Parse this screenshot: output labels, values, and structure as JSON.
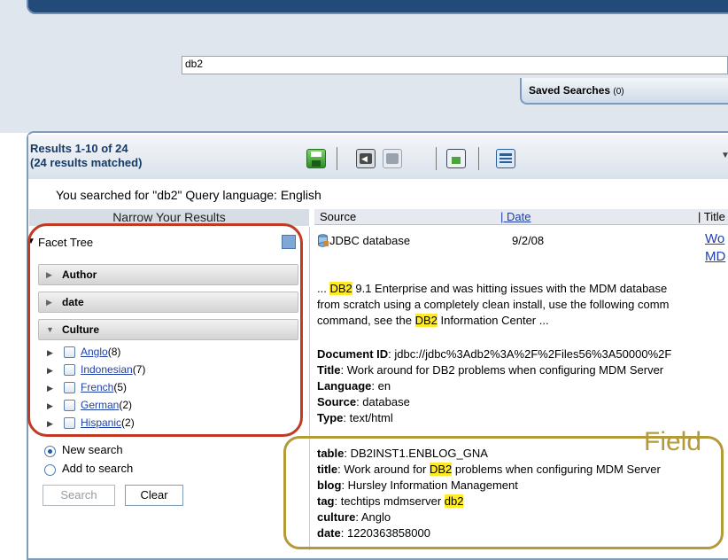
{
  "search": {
    "query": "db2"
  },
  "saved_searches": {
    "label": "Saved Searches",
    "count": "(0)"
  },
  "results": {
    "count_line1": "Results 1-10 of 24",
    "count_line2": "(24 results matched)",
    "searched_text": "You searched for \"db2\" Query language: English"
  },
  "toolbar": {
    "icons": [
      "save-icon",
      "back-icon",
      "forward-icon",
      "image-icon",
      "list-icon"
    ],
    "chevron": "▼"
  },
  "narrow": {
    "title": "Narrow Your Results",
    "facet_tree": "Facet Tree",
    "facets": [
      "Author",
      "date",
      "Culture"
    ],
    "culture_items": [
      {
        "name": "Anglo",
        "count": "(8)"
      },
      {
        "name": "Indonesian",
        "count": "(7)"
      },
      {
        "name": "French",
        "count": "(5)"
      },
      {
        "name": "German",
        "count": "(2)"
      },
      {
        "name": "Hispanic",
        "count": "(2)"
      }
    ],
    "new_search": "New search",
    "add_to_search": "Add to search",
    "search_button": "Search",
    "clear_button": "Clear"
  },
  "columns": {
    "source": "Source",
    "date": "| Date",
    "title": "| Title"
  },
  "result": {
    "source": "JDBC database",
    "date": "9/2/08",
    "title_link_1": "Wo",
    "title_link_2": "MD",
    "snippet_pre": "... ",
    "snippet_hl": "DB2",
    "snippet_1": " 9.1 Enterprise and was hitting issues with the MDM database",
    "snippet_2": "from scratch using a completely clean install, use the following comm",
    "snippet_3_pre": "command, see the ",
    "snippet_3_post": " Information Center ...",
    "doc_id_label": "Document ID",
    "doc_id_value": ": jdbc://jdbc%3Adb2%3A%2F%2Files56%3A50000%2F",
    "title_label": "Title",
    "title_value": ": Work around for DB2 problems when configuring MDM Server",
    "language_label": "Language",
    "language_value": ": en",
    "source_label": "Source",
    "source_value": ": database",
    "type_label": "Type",
    "type_value": ": text/html",
    "fields": {
      "table_label": "table",
      "table_value": ": DB2INST1.ENBLOG_GNA",
      "title_label": "title",
      "title_pre": ": Work around for ",
      "title_hl": "DB2",
      "title_post": " problems when configuring MDM Server",
      "blog_label": "blog",
      "blog_value": ": Hursley Information Management",
      "tag_label": "tag",
      "tag_pre": ": techtips mdmserver ",
      "tag_hl": "db2",
      "culture_label": "culture",
      "culture_value": ": Anglo",
      "date_label": "date",
      "date_value": ": 1220363858000"
    }
  },
  "annotation": {
    "field_label": "Field",
    "oval_color": "#c13a24",
    "box_color": "#b59a3a"
  }
}
